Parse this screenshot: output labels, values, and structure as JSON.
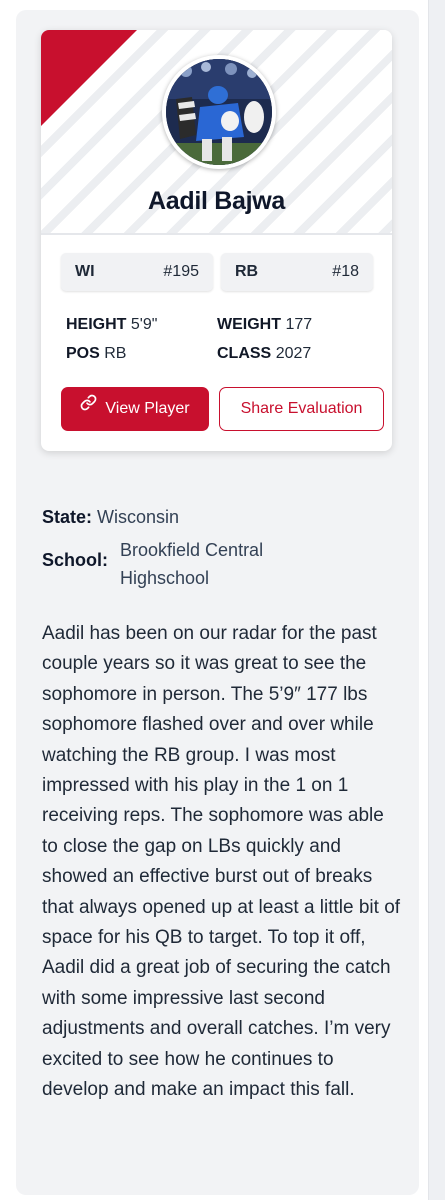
{
  "player": {
    "name": "Aadil Bajwa",
    "avatar_icon": "player-photo",
    "state_abbr": "WI",
    "state_rank": "#195",
    "position_abbr": "RB",
    "position_rank": "#18",
    "height_label": "HEIGHT",
    "height_value": "5'9\"",
    "weight_label": "WEIGHT",
    "weight_value": "177",
    "pos_label": "POS",
    "pos_value": "RB",
    "class_label": "CLASS",
    "class_value": "2027"
  },
  "actions": {
    "view_player": "View Player",
    "view_player_icon": "link-icon",
    "share_evaluation": "Share Evaluation"
  },
  "details": {
    "state_label": "State:",
    "state_value": "Wisconsin",
    "school_label": "School:",
    "school_value_line1": "Brookfield Central",
    "school_value_line2": "Highschool"
  },
  "evaluation": {
    "text": "Aadil has been on our radar for the past couple years so it was great to see the sophomore in person. The 5’9″ 177 lbs sophomore flashed over and over while watching the RB group. I was most impressed with his play in the 1 on 1 receiving reps. The sophomore was able to close the gap on LBs quickly and showed an effective burst out of breaks that always opened up at least a little bit of space for his QB to target. To top it off, Aadil did a great job of securing the catch with some impressive last second adjustments and overall catches. I’m very excited to see how he continues to develop and make an impact this fall."
  },
  "colors": {
    "accent": "#c8102e",
    "panel": "#f2f3f5",
    "text": "#1f2937"
  }
}
